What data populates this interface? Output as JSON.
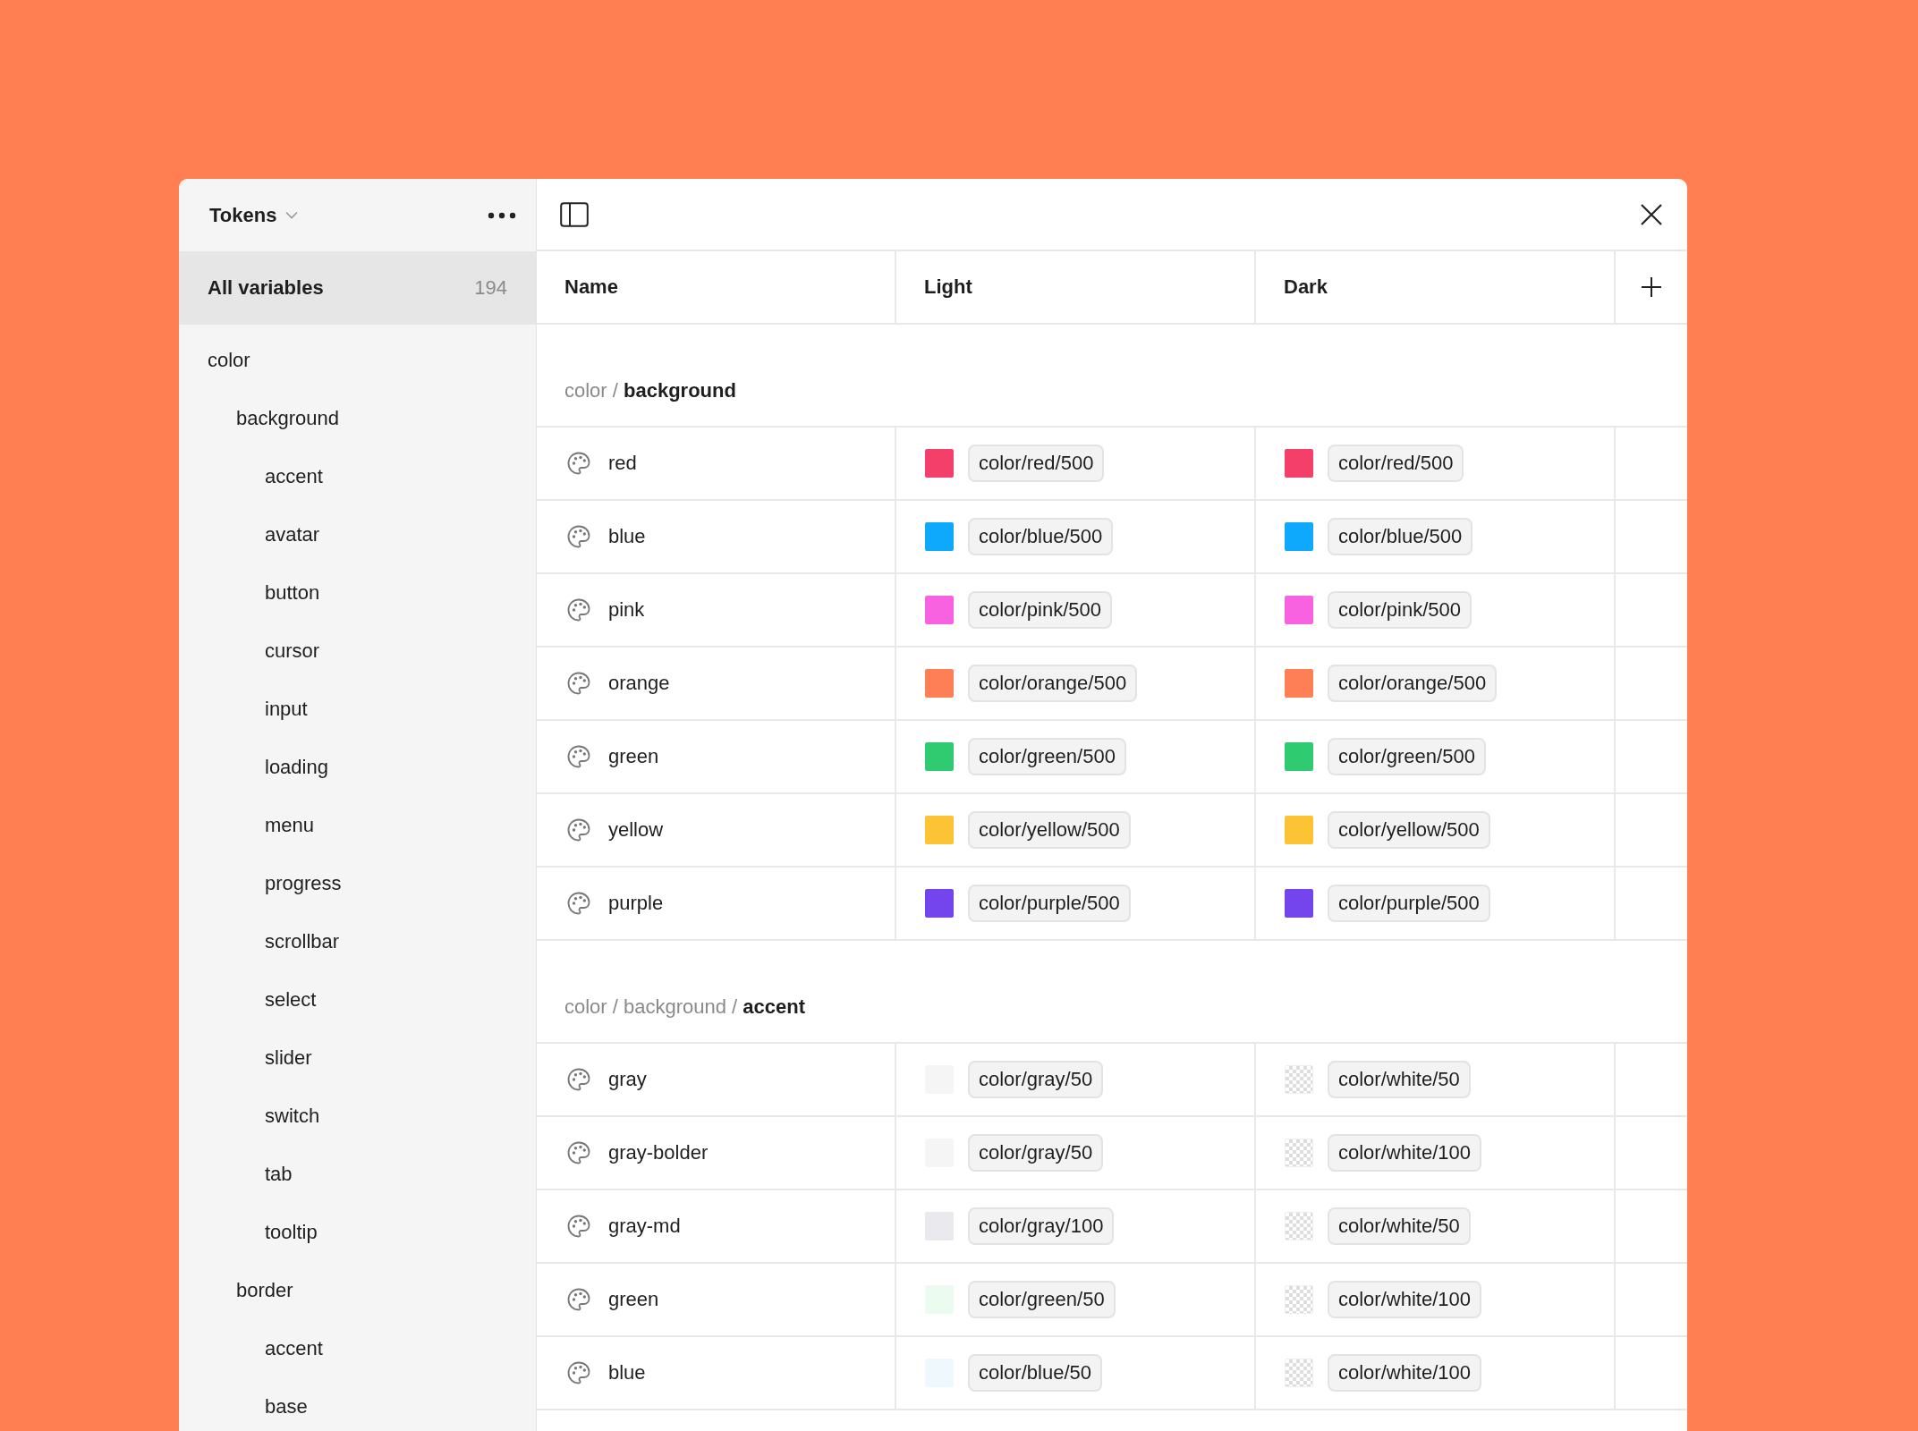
{
  "header": {
    "title": "Tokens"
  },
  "sidebar": {
    "all": {
      "label": "All variables",
      "count": "194",
      "selected": true
    },
    "tree": [
      {
        "label": "color",
        "children": [
          {
            "label": "background",
            "children": [
              {
                "label": "accent"
              },
              {
                "label": "avatar"
              },
              {
                "label": "button"
              },
              {
                "label": "cursor"
              },
              {
                "label": "input"
              },
              {
                "label": "loading"
              },
              {
                "label": "menu"
              },
              {
                "label": "progress"
              },
              {
                "label": "scrollbar"
              },
              {
                "label": "select"
              },
              {
                "label": "slider"
              },
              {
                "label": "switch"
              },
              {
                "label": "tab"
              },
              {
                "label": "tooltip"
              }
            ]
          },
          {
            "label": "border",
            "children": [
              {
                "label": "accent"
              },
              {
                "label": "base"
              }
            ]
          }
        ]
      }
    ]
  },
  "table": {
    "columns": [
      "Name",
      "Light",
      "Dark"
    ],
    "groups": [
      {
        "title": "color / **background**",
        "rows": [
          {
            "name": "red",
            "light": {
              "kind": "solid",
              "color": "#f43f6b",
              "value": "color/red/500"
            },
            "dark": {
              "kind": "solid",
              "color": "#f43f6b",
              "value": "color/red/500"
            }
          },
          {
            "name": "blue",
            "light": {
              "kind": "solid",
              "color": "#0ea8fc",
              "value": "color/blue/500"
            },
            "dark": {
              "kind": "solid",
              "color": "#0ea8fc",
              "value": "color/blue/500"
            }
          },
          {
            "name": "pink",
            "light": {
              "kind": "solid",
              "color": "#f862e0",
              "value": "color/pink/500"
            },
            "dark": {
              "kind": "solid",
              "color": "#f862e0",
              "value": "color/pink/500"
            }
          },
          {
            "name": "orange",
            "light": {
              "kind": "solid",
              "color": "#fe7f55",
              "value": "color/orange/500"
            },
            "dark": {
              "kind": "solid",
              "color": "#fe7f55",
              "value": "color/orange/500"
            }
          },
          {
            "name": "green",
            "light": {
              "kind": "solid",
              "color": "#2ecb71",
              "value": "color/green/500"
            },
            "dark": {
              "kind": "solid",
              "color": "#2ecb71",
              "value": "color/green/500"
            }
          },
          {
            "name": "yellow",
            "light": {
              "kind": "solid",
              "color": "#fcc434",
              "value": "color/yellow/500"
            },
            "dark": {
              "kind": "solid",
              "color": "#fcc434",
              "value": "color/yellow/500"
            }
          },
          {
            "name": "purple",
            "light": {
              "kind": "solid",
              "color": "#7444ec",
              "value": "color/purple/500"
            },
            "dark": {
              "kind": "solid",
              "color": "#7444ec",
              "value": "color/purple/500"
            }
          }
        ]
      },
      {
        "title": "color / background / **accent**",
        "rows": [
          {
            "name": "gray",
            "light": {
              "kind": "solid",
              "color": "#f5f5f6",
              "value": "color/gray/50"
            },
            "dark": {
              "kind": "checker",
              "value": "color/white/50"
            }
          },
          {
            "name": "gray-bolder",
            "light": {
              "kind": "solid",
              "color": "#f5f5f6",
              "value": "color/gray/50"
            },
            "dark": {
              "kind": "checker",
              "value": "color/white/100"
            }
          },
          {
            "name": "gray-md",
            "light": {
              "kind": "solid",
              "color": "#e9e9ee",
              "value": "color/gray/100"
            },
            "dark": {
              "kind": "checker",
              "value": "color/white/50"
            }
          },
          {
            "name": "green",
            "light": {
              "kind": "solid",
              "color": "#ecfbf0",
              "value": "color/green/50"
            },
            "dark": {
              "kind": "checker",
              "value": "color/white/100"
            }
          },
          {
            "name": "blue",
            "light": {
              "kind": "solid",
              "color": "#eff8fd",
              "value": "color/blue/50"
            },
            "dark": {
              "kind": "checker",
              "value": "color/white/100"
            }
          }
        ]
      }
    ]
  }
}
